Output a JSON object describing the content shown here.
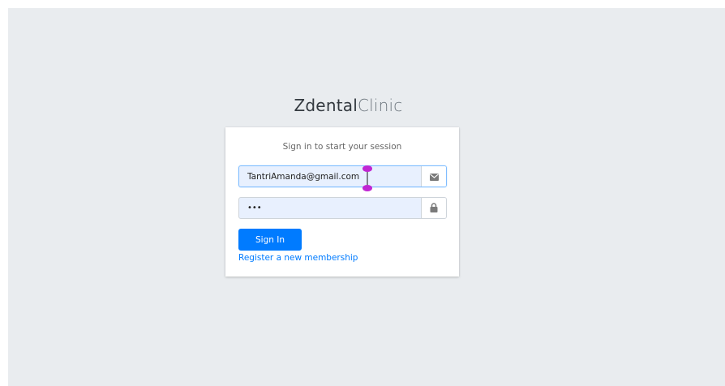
{
  "brand": {
    "bold": "Zdental",
    "light": "Clinic"
  },
  "login": {
    "message": "Sign in to start your session",
    "email_value": "TantriAmanda@gmail.com",
    "password_value": "•••",
    "signin_label": "Sign In",
    "register_label": "Register a new membership"
  },
  "icons": {
    "email": "envelope-icon",
    "password": "lock-icon"
  },
  "colors": {
    "primary": "#007bff",
    "background": "#e9ecef",
    "input_autofill": "#e8f0fe",
    "cursor_handle": "#c026d3"
  }
}
